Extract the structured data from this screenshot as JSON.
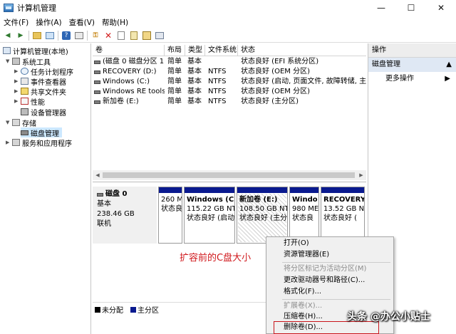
{
  "window": {
    "title": "计算机管理",
    "minimize_icon": "—",
    "maximize_icon": "☐",
    "close_icon": "✕"
  },
  "menu": [
    "文件(F)",
    "操作(A)",
    "查看(V)",
    "帮助(H)"
  ],
  "tree": {
    "root": "计算机管理(本地)",
    "system_tools": "系统工具",
    "task_scheduler": "任务计划程序",
    "event_viewer": "事件查看器",
    "shared_folders": "共享文件夹",
    "performance": "性能",
    "device_manager": "设备管理器",
    "storage": "存储",
    "disk_management": "磁盘管理",
    "services_apps": "服务和应用程序"
  },
  "columns": [
    "卷",
    "布局",
    "类型",
    "文件系统",
    "状态"
  ],
  "volumes": [
    {
      "name": "(磁盘 0 磁盘分区 1)",
      "layout": "简单",
      "type": "基本",
      "fs": "",
      "status": "状态良好 (EFI 系统分区)"
    },
    {
      "name": "RECOVERY (D:)",
      "layout": "简单",
      "type": "基本",
      "fs": "NTFS",
      "status": "状态良好 (OEM 分区)"
    },
    {
      "name": "Windows (C:)",
      "layout": "简单",
      "type": "基本",
      "fs": "NTFS",
      "status": "状态良好 (启动, 页面文件, 故障转储, 主分"
    },
    {
      "name": "Windows RE tools",
      "layout": "简单",
      "type": "基本",
      "fs": "NTFS",
      "status": "状态良好 (OEM 分区)"
    },
    {
      "name": "新加卷 (E:)",
      "layout": "简单",
      "type": "基本",
      "fs": "NTFS",
      "status": "状态良好 (主分区)"
    }
  ],
  "disk": {
    "name": "磁盘 0",
    "type": "基本",
    "size": "238.46 GB",
    "state": "联机"
  },
  "partitions": [
    {
      "name": "",
      "size": "260 M",
      "status": "状态良"
    },
    {
      "name": "Windows (C:",
      "size": "115.22 GB NT",
      "status": "状态良好 (启动"
    },
    {
      "name": "新加卷 (E:)",
      "size": "108.50 GB NT",
      "status": "状态良好 (主分"
    },
    {
      "name": "Windo",
      "size": "980 ME",
      "status": "状态良"
    },
    {
      "name": "RECOVERY",
      "size": "13.52 GB N",
      "status": "状态良好 ("
    }
  ],
  "annotation": "扩容前的C盘大小",
  "legend": {
    "unallocated": "未分配",
    "primary": "主分区",
    "unallocated_color": "#000000",
    "primary_color": "#0a1a8f"
  },
  "actions": {
    "header": "操作",
    "section": "磁盘管理",
    "more": "更多操作",
    "section_arrow": "▲",
    "more_arrow": "▶"
  },
  "context_menu": {
    "open": "打开(O)",
    "explorer": "资源管理器(E)",
    "mark_active": "将分区标记为活动分区(M)",
    "change_letter": "更改驱动器号和路径(C)...",
    "format": "格式化(F)...",
    "extend": "扩展卷(X)...",
    "shrink": "压缩卷(H)...",
    "delete": "删除卷(D)..."
  },
  "watermark": "头条 @办公小贴士",
  "colors": {
    "partition_bar": "#0a1a8f",
    "annotation": "#d0181c",
    "highlight_border": "#c8141a"
  }
}
